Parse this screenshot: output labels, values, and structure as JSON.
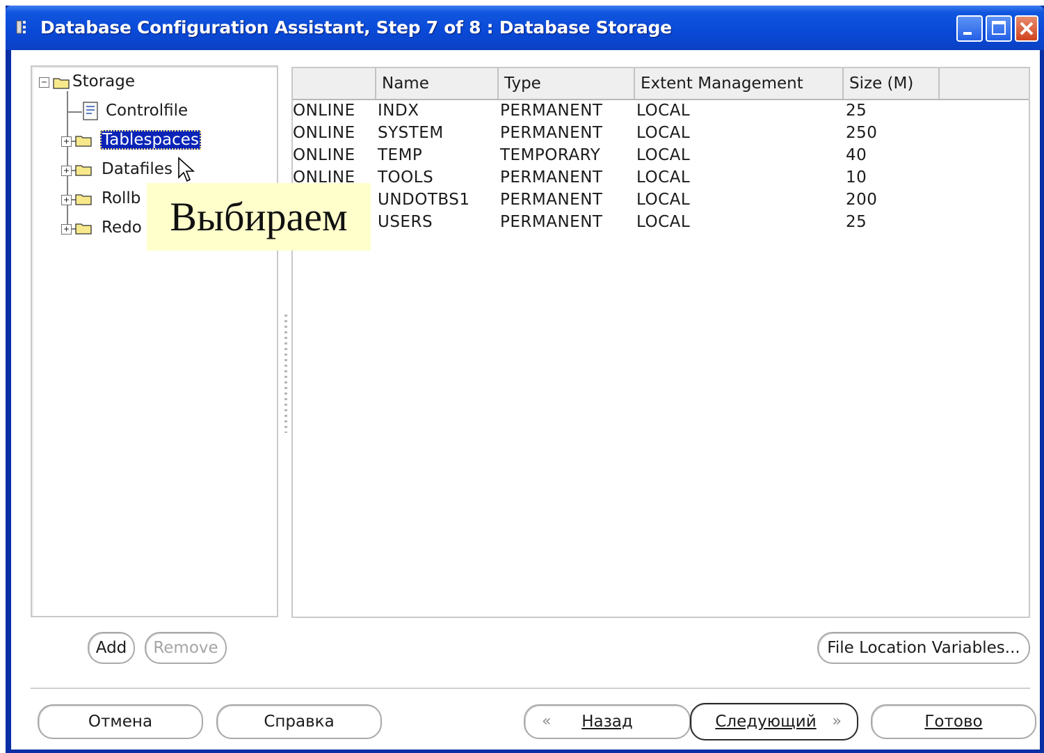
{
  "window": {
    "title": "Database Configuration Assistant, Step 7 of 8 : Database Storage"
  },
  "tree": {
    "root_label": "Storage",
    "items": [
      {
        "label": "Controlfile"
      },
      {
        "label": "Tablespaces",
        "selected": true
      },
      {
        "label": "Datafiles"
      },
      {
        "label": "Rollb"
      },
      {
        "label": "Redo"
      }
    ]
  },
  "table": {
    "columns": [
      "",
      "Name",
      "Type",
      "Extent Management",
      "Size (M)"
    ],
    "rows": [
      [
        "ONLINE",
        "INDX",
        "PERMANENT",
        "LOCAL",
        "25"
      ],
      [
        "ONLINE",
        "SYSTEM",
        "PERMANENT",
        "LOCAL",
        "250"
      ],
      [
        "ONLINE",
        "TEMP",
        "TEMPORARY",
        "LOCAL",
        "40"
      ],
      [
        "ONLINE",
        "TOOLS",
        "PERMANENT",
        "LOCAL",
        "10"
      ],
      [
        "",
        "UNDOTBS1",
        "PERMANENT",
        "LOCAL",
        "200"
      ],
      [
        "",
        "USERS",
        "PERMANENT",
        "LOCAL",
        "25"
      ]
    ]
  },
  "buttons": {
    "add": "Add",
    "remove": "Remove",
    "file_location": "File Location Variables...",
    "cancel": "Отмена",
    "help": "Справка",
    "back": "Назад",
    "next": "Следующий",
    "finish": "Готово"
  },
  "annotation": {
    "text": "Выбираем"
  },
  "colors": {
    "titlebar": "#0a4ad8",
    "selection": "#0a24b8",
    "callout": "#ffffcc"
  }
}
